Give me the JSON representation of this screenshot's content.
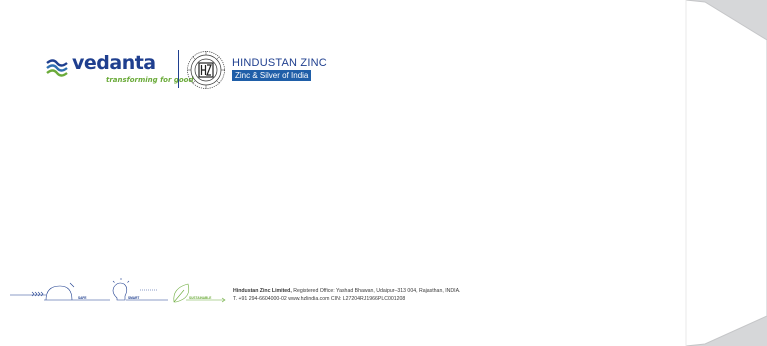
{
  "brand": {
    "vedanta_name": "vedanta",
    "vedanta_tagline": "transforming for good",
    "hz_name": "HINDUSTAN ZINC",
    "hz_tagline": "Zinc & Silver of India"
  },
  "footer": {
    "labels": {
      "safe": "SAFE",
      "smart": "SMART",
      "sustainable": "SUSTAINABLE"
    },
    "company": "Hindustan Zinc Limited,",
    "registered_office": " Registered Office: Yashad Bhawan, Udaipur–313 004, Rajasthan, INDIA.",
    "contact": "T. +91 294-6604000-02   www.hzlindia.com   CIN: L27204RJ1966PLC001208"
  },
  "colors": {
    "vedanta_blue": "#1f3f8f",
    "vedanta_green": "#6bab3a",
    "hz_blue": "#1f5ea8",
    "background": "#d6d7d9"
  }
}
